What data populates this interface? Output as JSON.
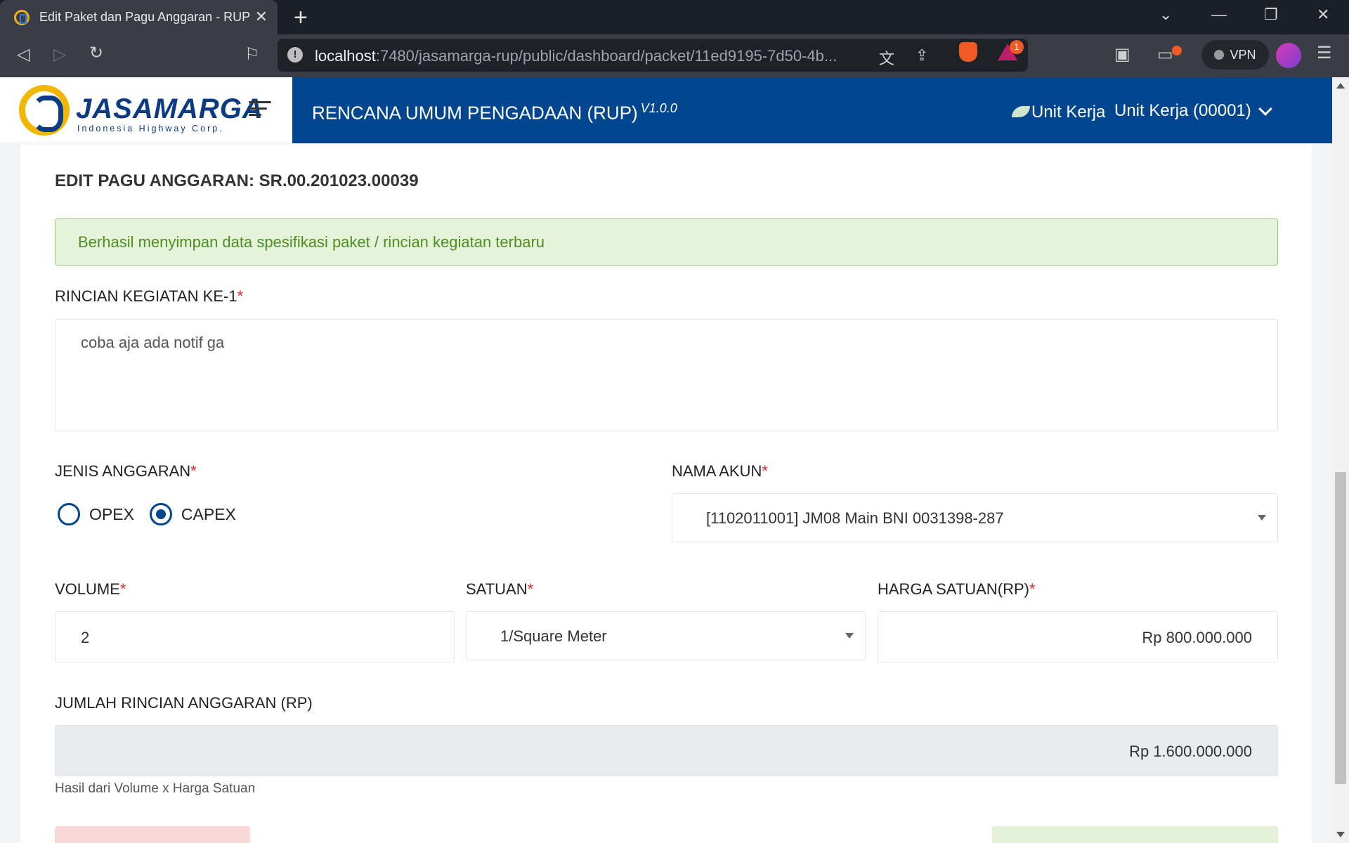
{
  "browser": {
    "tab_title": "Edit Paket dan Pagu Anggaran - RUP",
    "url_host": "localhost",
    "url_path": ":7480/jasamarga-rup/public/dashboard/packet/11ed9195-7d50-4b...",
    "rewards_badge": "1",
    "vpn_label": "VPN"
  },
  "header": {
    "logo_text": "JASAMARGA",
    "logo_subtitle": "Indonesia Highway Corp.",
    "app_title": "RENCANA UMUM PENGADAAN (RUP)",
    "version": "V1.0.0",
    "unit_label": "Unit Kerja",
    "unit_value": "Unit Kerja (00001)"
  },
  "form": {
    "heading_label": "EDIT PAGU ANGGARAN:",
    "heading_code": "SR.00.201023.00039",
    "alert_text": "Berhasil menyimpan data spesifikasi paket / rincian kegiatan terbaru",
    "rincian_label": "RINCIAN KEGIATAN KE-1",
    "rincian_value": "coba aja ada notif ga",
    "jenis_label": "JENIS ANGGARAN",
    "jenis_options": [
      "OPEX",
      "CAPEX"
    ],
    "jenis_selected": "CAPEX",
    "akun_label": "NAMA AKUN",
    "akun_value": "[1102011001] JM08 Main BNI 0031398-287",
    "volume_label": "VOLUME",
    "volume_value": "2",
    "satuan_label": "SATUAN",
    "satuan_value": "1/Square Meter",
    "harga_label": "HARGA SATUAN(RP)",
    "harga_value": "Rp 800.000.000",
    "jumlah_label": "JUMLAH RINCIAN ANGGARAN (RP)",
    "jumlah_value": "Rp 1.600.000.000",
    "jumlah_helper": "Hasil dari Volume x Harga Satuan",
    "required_mark": "*"
  },
  "colors": {
    "brand_blue": "#01468e",
    "brand_yellow": "#f2b705",
    "alert_bg": "#e4f3d9",
    "alert_text": "#4f8f22",
    "required": "#e02b2b"
  }
}
